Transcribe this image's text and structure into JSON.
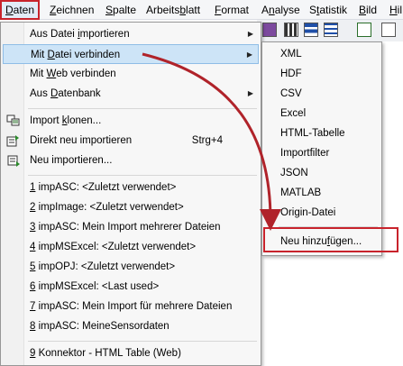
{
  "menubar": {
    "items": [
      {
        "pre": "",
        "ul": "D",
        "post": "aten"
      },
      {
        "pre": "",
        "ul": "Z",
        "post": "eichnen"
      },
      {
        "pre": "",
        "ul": "S",
        "post": "palte"
      },
      {
        "pre": "Arbeits",
        "ul": "b",
        "post": "latt"
      },
      {
        "pre": "",
        "ul": "F",
        "post": "ormat"
      },
      {
        "pre": "A",
        "ul": "n",
        "post": "alyse"
      },
      {
        "pre": "S",
        "ul": "t",
        "post": "atistik"
      },
      {
        "pre": "",
        "ul": "B",
        "post": "ild"
      },
      {
        "pre": "",
        "ul": "H",
        "post": "il"
      }
    ]
  },
  "toolbar": {
    "icons": [
      "color-palette-icon",
      "film-strip-icon",
      "chart-bar-icon",
      "list-icon",
      "tree-icon",
      "window-icon"
    ]
  },
  "data_menu": {
    "items": [
      {
        "pre": "Aus Datei ",
        "ul": "i",
        "post": "mportieren",
        "submenu": true
      },
      {
        "pre": "Mit ",
        "ul": "D",
        "post": "atei verbinden",
        "submenu": true,
        "highlighted": true
      },
      {
        "pre": "Mit ",
        "ul": "W",
        "post": "eb verbinden",
        "submenu": false
      },
      {
        "pre": "Aus ",
        "ul": "D",
        "post": "atenbank",
        "submenu": true
      },
      {
        "pre": "Import ",
        "ul": "k",
        "post": "lonen...",
        "icon": "import-clone-icon"
      },
      {
        "pre": "Direkt neu importieren",
        "ul": "",
        "post": "",
        "shortcut": "Strg+4",
        "icon": "reimport-direct-icon"
      },
      {
        "pre": "Neu importieren...",
        "ul": "",
        "post": "",
        "icon": "reimport-dialog-icon"
      },
      {
        "pre": "",
        "ul": "1",
        "post": " impASC: <Zuletzt verwendet>"
      },
      {
        "pre": "",
        "ul": "2",
        "post": " impImage: <Zuletzt verwendet>"
      },
      {
        "pre": "",
        "ul": "3",
        "post": " impASC: Mein Import mehrerer Dateien"
      },
      {
        "pre": "",
        "ul": "4",
        "post": " impMSExcel: <Zuletzt verwendet>"
      },
      {
        "pre": "",
        "ul": "5",
        "post": " impOPJ: <Zuletzt verwendet>"
      },
      {
        "pre": "",
        "ul": "6",
        "post": " impMSExcel: <Last used>"
      },
      {
        "pre": "",
        "ul": "7",
        "post": " impASC: Mein Import für mehrere Dateien"
      },
      {
        "pre": "",
        "ul": "8",
        "post": " impASC: MeineSensordaten"
      },
      {
        "pre": "",
        "ul": "9",
        "post": " Konnektor - HTML Table (Web)"
      }
    ]
  },
  "submenu": {
    "items": [
      {
        "pre": "XML",
        "ul": "",
        "post": ""
      },
      {
        "pre": "HDF",
        "ul": "",
        "post": ""
      },
      {
        "pre": "CSV",
        "ul": "",
        "post": ""
      },
      {
        "pre": "Excel",
        "ul": "",
        "post": ""
      },
      {
        "pre": "HTML-Tabelle",
        "ul": "",
        "post": ""
      },
      {
        "pre": "Importfilter",
        "ul": "",
        "post": ""
      },
      {
        "pre": "JSON",
        "ul": "",
        "post": ""
      },
      {
        "pre": "MATLAB",
        "ul": "",
        "post": ""
      },
      {
        "pre": "Origin-Datei",
        "ul": "",
        "post": ""
      },
      {
        "pre": "Neu hinzu",
        "ul": "f",
        "post": "ügen..."
      }
    ]
  },
  "colors": {
    "highlight_border": "#c8232c",
    "arrow": "#b0232a",
    "menu_highlight": "#cde4f7"
  }
}
